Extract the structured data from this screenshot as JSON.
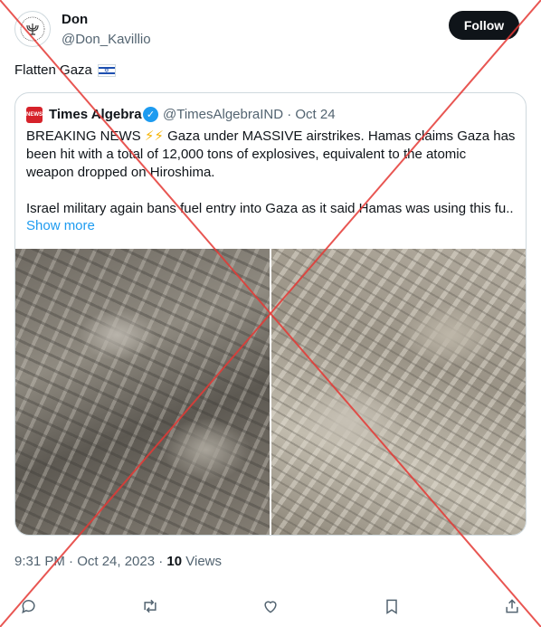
{
  "author": {
    "name": "Don",
    "handle": "@Don_Kavillio",
    "follow_label": "Follow",
    "avatar_icon": "menorah-emblem-icon"
  },
  "tweet": {
    "text": "Flatten Gaza",
    "emoji_icon": "israel-flag-icon"
  },
  "quote": {
    "name": "Times Algebra",
    "verified_icon": "verified-badge-icon",
    "handle": "@TimesAlgebraIND",
    "date": "Oct 24",
    "meta": "@TimesAlgebraIND · Oct 24",
    "avatar_text": "NEWS",
    "line1_prefix": "BREAKING NEWS",
    "line1_suffix": "Gaza under MASSIVE airstrikes. Hamas claims Gaza has",
    "line2": "been hit with a total of 12,000 tons of explosives, equivalent to the atomic",
    "line3": "weapon dropped on Hiroshima.",
    "line4": "Israel military again bans fuel entry into Gaza as it said Hamas was using this fu...",
    "show_more": "Show more",
    "images": [
      {
        "icon": "destroyed-buildings-photo"
      },
      {
        "icon": "aerial-rubble-photo"
      }
    ]
  },
  "footer": {
    "time": "9:31 PM · Oct 24, 2023 · ",
    "views_count": "10",
    "views_label": " Views"
  },
  "actions": [
    {
      "name": "reply-icon"
    },
    {
      "name": "retweet-icon"
    },
    {
      "name": "like-icon"
    },
    {
      "name": "bookmark-icon"
    },
    {
      "name": "share-icon"
    }
  ],
  "colors": {
    "accent": "#1d9bf0",
    "text": "#0f1419",
    "muted": "#536471",
    "border": "#cfd9de",
    "overlay_cross": "#e53935"
  }
}
